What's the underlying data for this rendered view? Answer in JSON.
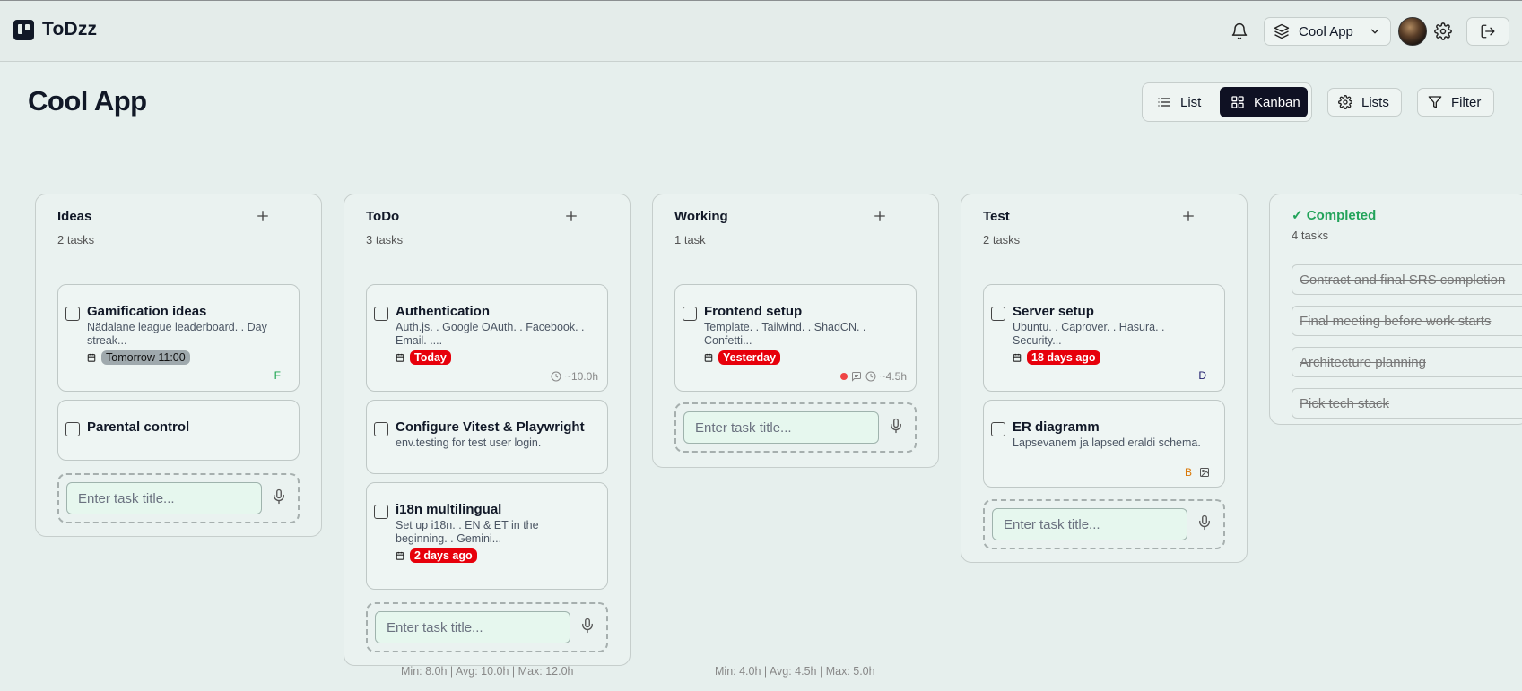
{
  "header": {
    "brand": "ToDzz",
    "app_selector": "Cool App"
  },
  "page": {
    "title": "Cool App",
    "view_list": "List",
    "view_kanban": "Kanban",
    "lists_button": "Lists",
    "filter_button": "Filter"
  },
  "add_placeholder": "Enter task title...",
  "columns": {
    "ideas": {
      "title": "Ideas",
      "count": "2 tasks",
      "cards": [
        {
          "title": "Gamification ideas",
          "desc": "Nädalane league leaderboard. . Day streak...",
          "date": "Tomorrow 11:00",
          "initial": "F"
        },
        {
          "title": "Parental control"
        }
      ]
    },
    "todo": {
      "title": "ToDo",
      "count": "3 tasks",
      "cards": [
        {
          "title": "Authentication",
          "desc": "Auth.js. . Google OAuth. . Facebook. . Email. ....",
          "date": "Today",
          "estimate": "~10.0h"
        },
        {
          "title": "Configure Vitest & Playwright",
          "desc": "env.testing for test user login."
        },
        {
          "title": "i18n multilingual",
          "desc": "Set up i18n. . EN & ET in the beginning. . Gemini...",
          "date": "2 days ago"
        }
      ],
      "stats": "Min: 8.0h | Avg: 10.0h | Max: 12.0h"
    },
    "working": {
      "title": "Working",
      "count": "1 task",
      "cards": [
        {
          "title": "Frontend setup",
          "desc": "Template. . Tailwind. . ShadCN. . Confetti...",
          "date": "Yesterday",
          "estimate": "~4.5h"
        }
      ],
      "stats": "Min: 4.0h | Avg: 4.5h | Max: 5.0h"
    },
    "test": {
      "title": "Test",
      "count": "2 tasks",
      "cards": [
        {
          "title": "Server setup",
          "desc": "Ubuntu. . Caprover. . Hasura. . Security...",
          "date": "18 days ago",
          "initial": "D"
        },
        {
          "title": "ER diagramm",
          "desc": "Lapsevanem ja lapsed eraldi schema.",
          "initial": "B"
        }
      ]
    },
    "completed": {
      "title": "✓ Completed",
      "count": "4 tasks",
      "items": [
        "Contract and final SRS completion",
        "Final meeting before work starts",
        "Architecture planning",
        "Pick tech stack"
      ]
    }
  },
  "colors": {
    "background": "#e6efed",
    "accent_dark": "#0f1123",
    "overdue_red": "#e7000b",
    "completed_green": "#22a35a"
  }
}
